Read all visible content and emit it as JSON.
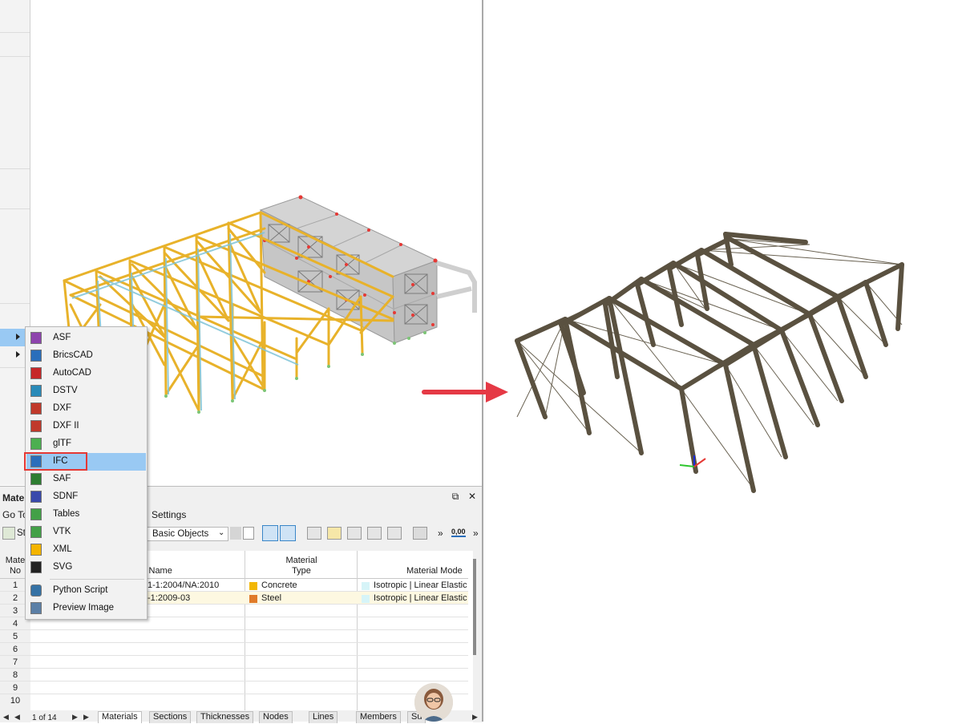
{
  "panel": {
    "title": "Mate",
    "restore_icon": "⧉",
    "close_icon": "✕"
  },
  "menubar": {
    "goto": "Go To",
    "settings": "Settings"
  },
  "toolbar": {
    "st_label": "St",
    "dropdown_value": "Basic Objects",
    "overflow1": "»",
    "overflow2": "»",
    "number_icon_text": "0,00"
  },
  "export_menu": {
    "items": [
      {
        "label": "ASF",
        "icon": "asf-file-icon",
        "color": "#8e44ad"
      },
      {
        "label": "BricsCAD",
        "icon": "bricscad-icon",
        "color": "#2a6ebb"
      },
      {
        "label": "AutoCAD",
        "icon": "autocad-icon",
        "color": "#c62828"
      },
      {
        "label": "DSTV",
        "icon": "dstv-file-icon",
        "color": "#2a8ab8"
      },
      {
        "label": "DXF",
        "icon": "dxf-file-icon",
        "color": "#c0392b"
      },
      {
        "label": "DXF II",
        "icon": "dxf2-file-icon",
        "color": "#c0392b"
      },
      {
        "label": "glTF",
        "icon": "gltf-file-icon",
        "color": "#4caf50"
      },
      {
        "label": "IFC",
        "icon": "ifc-file-icon",
        "color": "#2a6ebb"
      },
      {
        "label": "SAF",
        "icon": "saf-file-icon",
        "color": "#2e7d32"
      },
      {
        "label": "SDNF",
        "icon": "sdnf-file-icon",
        "color": "#3949ab"
      },
      {
        "label": "Tables",
        "icon": "tables-file-icon",
        "color": "#43a047"
      },
      {
        "label": "VTK",
        "icon": "vtk-file-icon",
        "color": "#43a047"
      },
      {
        "label": "XML",
        "icon": "xml-file-icon",
        "color": "#f4b400"
      },
      {
        "label": "SVG",
        "icon": "svg-file-icon",
        "color": "#222222"
      },
      {
        "label": "Python Script",
        "icon": "python-icon",
        "color": "#3572a5"
      },
      {
        "label": "Preview Image",
        "icon": "preview-image-icon",
        "color": "#5b7fa6"
      }
    ],
    "highlighted": "IFC"
  },
  "table": {
    "rownum_header_1": "Mate",
    "rownum_header_2": "No",
    "col_name_header": "l Name",
    "col_type_header_1": "Material",
    "col_type_header_2": "Type",
    "col_model_header": "Material Mode",
    "row_numbers": [
      "1",
      "2",
      "3",
      "4",
      "5",
      "6",
      "7",
      "8",
      "9",
      "10"
    ],
    "rows": [
      {
        "name": "1-1:2004/NA:2010",
        "type": "Concrete",
        "type_color": "#f2b705",
        "model": "Isotropic | Linear Elastic"
      },
      {
        "name": "-1:2009-03",
        "type": "Steel",
        "type_color": "#e07b2a",
        "model": "Isotropic | Linear Elastic"
      }
    ]
  },
  "tabs": {
    "pager": "1 of 14",
    "items": [
      "Materials",
      "Sections",
      "Thicknesses",
      "Nodes",
      "Lines",
      "Members",
      "Su"
    ],
    "active": "Materials"
  }
}
